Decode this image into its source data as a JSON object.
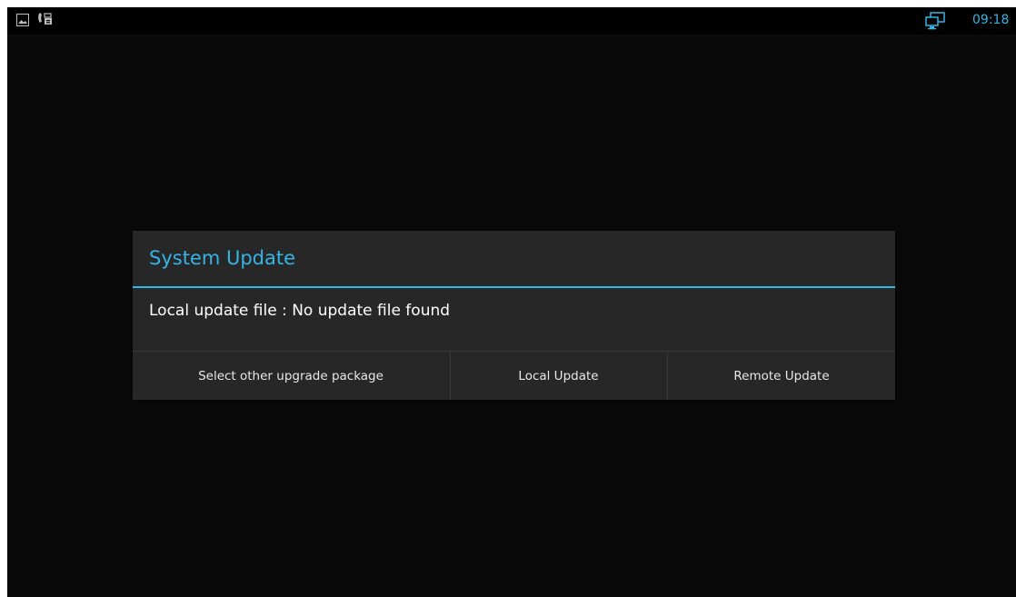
{
  "statusbar": {
    "left_icons": [
      "gallery-icon",
      "phone-voicemail-icon"
    ],
    "right_icon": "screen-share-icon",
    "time": "09:18",
    "accent_color": "#33b5e5"
  },
  "dialog": {
    "title": "System Update",
    "message": "Local update file : No update file found",
    "buttons": {
      "select_other": "Select other upgrade package",
      "local_update": "Local Update",
      "remote_update": "Remote Update"
    },
    "colors": {
      "title": "#33b5e5",
      "background": "#272727",
      "text": "#ffffff"
    }
  }
}
